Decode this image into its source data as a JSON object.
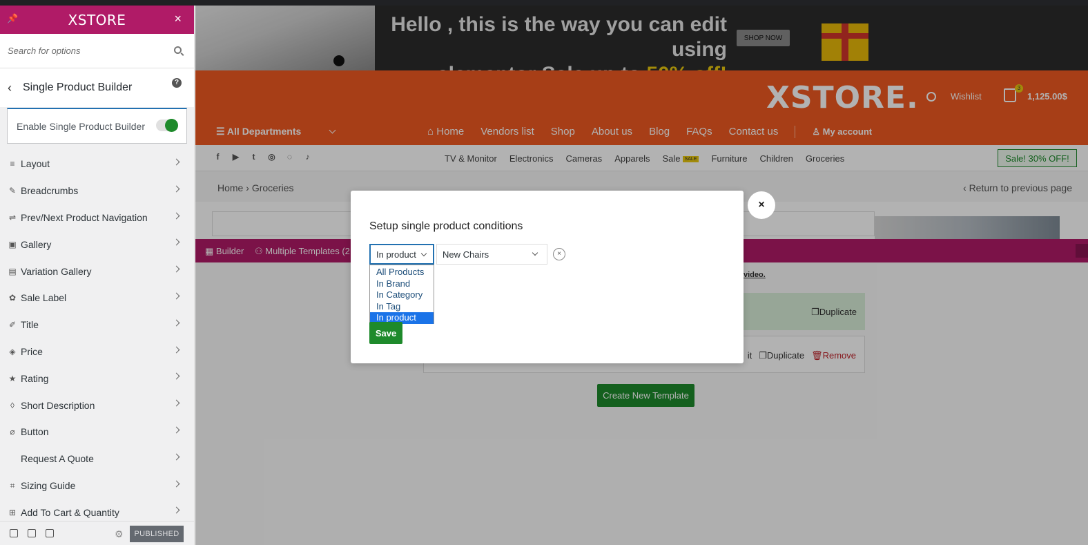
{
  "sidebar": {
    "logo": "XSTORE",
    "close_symbol": "×",
    "search_placeholder": "Search for options",
    "section_title": "Single Product Builder",
    "help_symbol": "?",
    "enable_label": "Enable Single Product Builder",
    "enable_on": true,
    "items": [
      {
        "label": "Layout",
        "icon": "layout-icon"
      },
      {
        "label": "Breadcrumbs",
        "icon": "breadcrumbs-icon"
      },
      {
        "label": "Prev/Next Product Navigation",
        "icon": "navigation-icon"
      },
      {
        "label": "Gallery",
        "icon": "gallery-icon"
      },
      {
        "label": "Variation Gallery",
        "icon": "variation-gallery-icon"
      },
      {
        "label": "Sale Label",
        "icon": "sale-label-icon"
      },
      {
        "label": "Title",
        "icon": "title-icon"
      },
      {
        "label": "Price",
        "icon": "price-tag-icon"
      },
      {
        "label": "Rating",
        "icon": "star-icon"
      },
      {
        "label": "Short Description",
        "icon": "description-icon"
      },
      {
        "label": "Button",
        "icon": "button-icon"
      },
      {
        "label": "Request A Quote",
        "icon": "quote-icon"
      },
      {
        "label": "Sizing Guide",
        "icon": "crop-icon"
      },
      {
        "label": "Add To Cart & Quantity",
        "icon": "cart-icon"
      }
    ],
    "publish_label": "PUBLISHED"
  },
  "banner": {
    "line1": "Hello , this is the way you can edit using",
    "line2_prefix": "elementor Sale up to ",
    "line2_highlight": "50% off!",
    "shop_now": "SHOP NOW"
  },
  "header": {
    "brand": "XSTORE.",
    "wishlist": "Wishlist",
    "cart_count": "3",
    "cart_total": "1,125.00$",
    "departments": "All Departments",
    "menu": [
      "Home",
      "Vendors list",
      "Shop",
      "About us",
      "Blog",
      "FAQs",
      "Contact us"
    ],
    "account": "My account"
  },
  "catbar": {
    "social_icons": [
      "facebook-icon",
      "youtube-icon",
      "twitter-icon",
      "instagram-icon",
      "whatsapp-icon",
      "tiktok-icon"
    ],
    "categories": [
      "TV & Monitor",
      "Electronics",
      "Cameras",
      "Apparels",
      "Sale",
      "Furniture",
      "Children",
      "Groceries"
    ],
    "sale_badge": "SALE",
    "sale_button": "Sale! 30% OFF!"
  },
  "breadcrumb": {
    "home": "Home",
    "separator": "›",
    "current": "Groceries",
    "return": "Return to previous page"
  },
  "builder": {
    "builder_tab": "Builder",
    "templates_tab": "Multiple Templates (2",
    "video_link": "video.",
    "duplicate": "Duplicate",
    "edit_fragment": "it",
    "remove": "Remove",
    "create_button": "Create New Template"
  },
  "modal": {
    "title": "Setup single product conditions",
    "condition_type": "In product",
    "condition_value": "New Chairs",
    "remove_symbol": "×",
    "options": [
      "All Products",
      "In Brand",
      "In Category",
      "In Tag",
      "In product"
    ],
    "selected_option_index": 4,
    "save": "Save",
    "close_symbol": "×"
  },
  "colors": {
    "sidebar_header": "#b01b67",
    "header_orange": "#f05a22",
    "accent_green": "#1e8a2b",
    "select_blue": "#1a73e8"
  }
}
